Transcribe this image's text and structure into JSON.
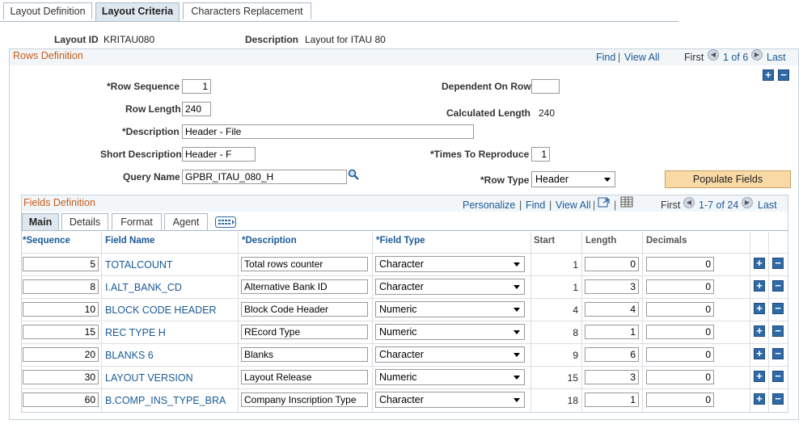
{
  "tabs": [
    {
      "label": "Layout Definition"
    },
    {
      "label": "Layout Criteria"
    },
    {
      "label": "Characters Replacement"
    }
  ],
  "header": {
    "layout_id_label": "Layout ID",
    "layout_id_value": "KRITAU080",
    "description_label": "Description",
    "description_value": "Layout for ITAU 80"
  },
  "rows_definition": {
    "title": "Rows Definition",
    "find": "Find",
    "sep": "|",
    "view_all": "View All",
    "first": "First",
    "range": "1 of 6",
    "last": "Last",
    "row_sequence_label": "*Row Sequence",
    "row_sequence": "1",
    "dependent_on_row_label": "Dependent On Row",
    "dependent_on_row": "",
    "row_length_label": "Row Length",
    "row_length": "240",
    "calculated_length_label": "Calculated Length",
    "calculated_length": "240",
    "description_label": "*Description",
    "description": "Header - File",
    "short_description_label": "Short Description",
    "short_description": "Header - F",
    "times_to_reproduce_label": "*Times To Reproduce",
    "times_to_reproduce": "1",
    "query_name_label": "Query Name",
    "query_name": "GPBR_ITAU_080_H",
    "row_type_label": "*Row Type",
    "row_type": "Header",
    "populate_fields": "Populate Fields"
  },
  "fields_definition": {
    "title": "Fields Definition",
    "personalize": "Personalize",
    "find": "Find",
    "sep": "|",
    "view_all": "View All",
    "first": "First",
    "range": "1-7 of 24",
    "last": "Last",
    "tabs": [
      {
        "label": "Main"
      },
      {
        "label": "Details"
      },
      {
        "label": "Format"
      },
      {
        "label": "Agent"
      }
    ],
    "columns": {
      "sequence": "*Sequence",
      "field_name": "Field Name",
      "description": "*Description",
      "field_type": "*Field Type",
      "start": "Start",
      "length": "Length",
      "decimals": "Decimals"
    },
    "rows": [
      {
        "sequence": "5",
        "field_name": "TOTALCOUNT",
        "description": "Total rows counter",
        "field_type": "Character",
        "start": "1",
        "length": "0",
        "decimals": "0"
      },
      {
        "sequence": "8",
        "field_name": "I.ALT_BANK_CD",
        "description": "Alternative Bank ID",
        "field_type": "Character",
        "start": "1",
        "length": "3",
        "decimals": "0"
      },
      {
        "sequence": "10",
        "field_name": "BLOCK CODE HEADER",
        "description": "Block Code Header",
        "field_type": "Numeric",
        "start": "4",
        "length": "4",
        "decimals": "0"
      },
      {
        "sequence": "15",
        "field_name": "REC TYPE H",
        "description": "REcord Type",
        "field_type": "Numeric",
        "start": "8",
        "length": "1",
        "decimals": "0"
      },
      {
        "sequence": "20",
        "field_name": "BLANKS 6",
        "description": "Blanks",
        "field_type": "Character",
        "start": "9",
        "length": "6",
        "decimals": "0"
      },
      {
        "sequence": "30",
        "field_name": "LAYOUT VERSION",
        "description": "Layout Release",
        "field_type": "Numeric",
        "start": "15",
        "length": "3",
        "decimals": "0"
      },
      {
        "sequence": "60",
        "field_name": "B.COMP_INS_TYPE_BRA",
        "description": "Company Inscription Type",
        "field_type": "Character",
        "start": "18",
        "length": "1",
        "decimals": "0"
      }
    ]
  },
  "icons": {
    "add": "+",
    "remove": "−",
    "prev": "◀",
    "next": "▶"
  }
}
